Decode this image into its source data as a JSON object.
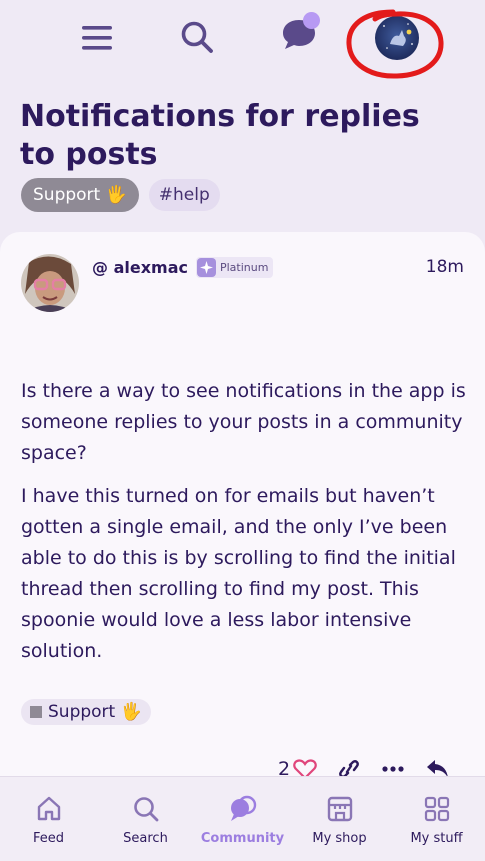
{
  "header": {
    "icons": [
      "hamburger-menu-icon",
      "search-icon",
      "chat-bubble-icon",
      "user-avatar"
    ]
  },
  "thread": {
    "title": "Notifications for replies to posts",
    "tags": [
      {
        "label": "Support 🖐"
      },
      {
        "label": "#help"
      }
    ]
  },
  "post": {
    "author": "@ alexmac",
    "badge": "Platinum",
    "time": "18m",
    "paragraphs": [
      "Is there a way to see notifications in the app is someone replies to your posts in a community space?",
      "I have this turned on for emails but haven’t gotten a single email, and the only I’ve been able to do this is by scrolling to find the initial thread then scrolling to find my post. This spoonie would love a less labor intensive solution."
    ],
    "tag": "Support 🖐",
    "like_count": "2"
  },
  "nav": {
    "items": [
      {
        "label": "Feed",
        "icon": "home-icon"
      },
      {
        "label": "Search",
        "icon": "search-icon"
      },
      {
        "label": "Community",
        "icon": "community-icon",
        "active": true
      },
      {
        "label": "My shop",
        "icon": "shop-icon"
      },
      {
        "label": "My stuff",
        "icon": "grid-icon"
      }
    ]
  },
  "colors": {
    "background": "#efeaf5",
    "card": "#faf7fc",
    "text": "#2d1a5d",
    "accent": "#9c7ee0",
    "annotation": "#e31b1b"
  }
}
